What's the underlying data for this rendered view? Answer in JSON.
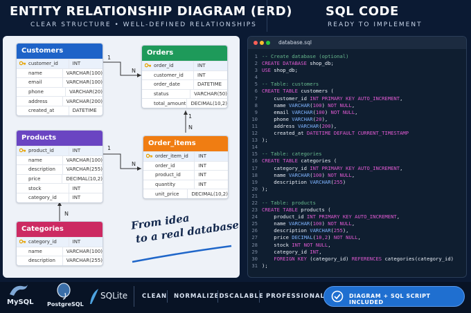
{
  "left_header": {
    "title": "ENTITY RELATIONSHIP DIAGRAM (ERD)",
    "subtitle": "CLEAR STRUCTURE  •  WELL-DEFINED RELATIONSHIPS"
  },
  "right_header": {
    "title": "SQL CODE",
    "subtitle": "READY TO IMPLEMENT"
  },
  "tables": {
    "customers": {
      "name": "Customers",
      "color": "#1e63c8",
      "rows": [
        [
          "customer_id",
          "INT"
        ],
        [
          "name",
          "VARCHAR(100)"
        ],
        [
          "email",
          "VARCHAR(100)"
        ],
        [
          "phone",
          "VARCHAR(20)"
        ],
        [
          "address",
          "VARCHAR(200)"
        ],
        [
          "created_at",
          "DATETIME"
        ]
      ]
    },
    "orders": {
      "name": "Orders",
      "color": "#1e9a5a",
      "rows": [
        [
          "order_id",
          "INT"
        ],
        [
          "customer_id",
          "INT"
        ],
        [
          "order_date",
          "DATETIME"
        ],
        [
          "status",
          "VARCHAR(50)"
        ],
        [
          "total_amount",
          "DECIMAL(10,2)"
        ]
      ]
    },
    "products": {
      "name": "Products",
      "color": "#6a45c2",
      "rows": [
        [
          "product_id",
          "INT"
        ],
        [
          "name",
          "VARCHAR(100)"
        ],
        [
          "description",
          "VARCHAR(255)"
        ],
        [
          "price",
          "DECIMAL(10,2)"
        ],
        [
          "stock",
          "INT"
        ],
        [
          "category_id",
          "INT"
        ]
      ]
    },
    "order_items": {
      "name": "Order_items",
      "color": "#f07d12",
      "rows": [
        [
          "order_item_id",
          "INT"
        ],
        [
          "order_id",
          "INT"
        ],
        [
          "product_id",
          "INT"
        ],
        [
          "quantity",
          "INT"
        ],
        [
          "unit_price",
          "DECIMAL(10,2)"
        ]
      ]
    },
    "categories": {
      "name": "Categories",
      "color": "#cc2a62",
      "rows": [
        [
          "category_id",
          "INT"
        ],
        [
          "name",
          "VARCHAR(100)"
        ],
        [
          "description",
          "VARCHAR(255)"
        ]
      ]
    }
  },
  "relations": {
    "one": "1",
    "many": "N"
  },
  "slogan": {
    "line1": "From idea",
    "line2": "to a real database"
  },
  "sql": {
    "file_name": "database.sql",
    "lines": [
      [
        [
          "cm",
          "-- Create database (optional)"
        ]
      ],
      [
        [
          "kw",
          "CREATE DATABASE"
        ],
        [
          "tx",
          " shop_db;"
        ]
      ],
      [
        [
          "kw",
          "USE"
        ],
        [
          "tx",
          " shop_db;"
        ]
      ],
      [],
      [
        [
          "cm",
          "-- Table: customers"
        ]
      ],
      [
        [
          "kw",
          "CREATE TABLE"
        ],
        [
          "tx",
          " customers ("
        ]
      ],
      [
        [
          "tx",
          "    customer_id "
        ],
        [
          "kw",
          "INT PRIMARY KEY AUTO_INCREMENT"
        ],
        [
          "tx",
          ","
        ]
      ],
      [
        [
          "tx",
          "    name "
        ],
        [
          "tp",
          "VARCHAR"
        ],
        [
          "tx",
          "("
        ],
        [
          "kw",
          "100"
        ],
        [
          "tx",
          ") "
        ],
        [
          "kw",
          "NOT NULL"
        ],
        [
          "tx",
          ","
        ]
      ],
      [
        [
          "tx",
          "    email "
        ],
        [
          "tp",
          "VARCHAR"
        ],
        [
          "tx",
          "("
        ],
        [
          "kw",
          "100"
        ],
        [
          "tx",
          ") "
        ],
        [
          "kw",
          "NOT NULL"
        ],
        [
          "tx",
          ","
        ]
      ],
      [
        [
          "tx",
          "    phone "
        ],
        [
          "tp",
          "VARCHAR"
        ],
        [
          "tx",
          "("
        ],
        [
          "kw",
          "20"
        ],
        [
          "tx",
          "),"
        ]
      ],
      [
        [
          "tx",
          "    address "
        ],
        [
          "tp",
          "VARCHAR"
        ],
        [
          "tx",
          "("
        ],
        [
          "kw",
          "200"
        ],
        [
          "tx",
          "),"
        ]
      ],
      [
        [
          "tx",
          "    created_at "
        ],
        [
          "kw",
          "DATETIME DEFAULT CURRENT_TIMESTAMP"
        ]
      ],
      [
        [
          "tx",
          ");"
        ]
      ],
      [],
      [
        [
          "cm",
          "-- Table: categories"
        ]
      ],
      [
        [
          "kw",
          "CREATE TABLE"
        ],
        [
          "tx",
          " categories ("
        ]
      ],
      [
        [
          "tx",
          "    category_id "
        ],
        [
          "kw",
          "INT PRIMARY KEY AUTO_INCREMENT"
        ],
        [
          "tx",
          ","
        ]
      ],
      [
        [
          "tx",
          "    name "
        ],
        [
          "tp",
          "VARCHAR"
        ],
        [
          "tx",
          "("
        ],
        [
          "kw",
          "100"
        ],
        [
          "tx",
          ") "
        ],
        [
          "kw",
          "NOT NULL"
        ],
        [
          "tx",
          ","
        ]
      ],
      [
        [
          "tx",
          "    description "
        ],
        [
          "tp",
          "VARCHAR"
        ],
        [
          "tx",
          "("
        ],
        [
          "kw",
          "255"
        ],
        [
          "tx",
          ")"
        ]
      ],
      [
        [
          "tx",
          ");"
        ]
      ],
      [],
      [
        [
          "cm",
          "-- Table: products"
        ]
      ],
      [
        [
          "kw",
          "CREATE TABLE"
        ],
        [
          "tx",
          " products ("
        ]
      ],
      [
        [
          "tx",
          "    product_id "
        ],
        [
          "kw",
          "INT PRIMARY KEY AUTO_INCREMENT"
        ],
        [
          "tx",
          ","
        ]
      ],
      [
        [
          "tx",
          "    name "
        ],
        [
          "tp",
          "VARCHAR"
        ],
        [
          "tx",
          "("
        ],
        [
          "kw",
          "100"
        ],
        [
          "tx",
          ") "
        ],
        [
          "kw",
          "NOT NULL"
        ],
        [
          "tx",
          ","
        ]
      ],
      [
        [
          "tx",
          "    description "
        ],
        [
          "tp",
          "VARCHAR"
        ],
        [
          "tx",
          "("
        ],
        [
          "kw",
          "255"
        ],
        [
          "tx",
          "),"
        ]
      ],
      [
        [
          "tx",
          "    price "
        ],
        [
          "tp",
          "DECIMAL"
        ],
        [
          "tx",
          "("
        ],
        [
          "kw",
          "10,2"
        ],
        [
          "tx",
          ") "
        ],
        [
          "kw",
          "NOT NULL"
        ],
        [
          "tx",
          ","
        ]
      ],
      [
        [
          "tx",
          "    stock "
        ],
        [
          "kw",
          "INT NOT NULL"
        ],
        [
          "tx",
          ","
        ]
      ],
      [
        [
          "tx",
          "    category_id "
        ],
        [
          "kw",
          "INT"
        ],
        [
          "tx",
          ","
        ]
      ],
      [
        [
          "tx",
          "    "
        ],
        [
          "kw",
          "FOREIGN KEY"
        ],
        [
          "tx",
          " (category_id) "
        ],
        [
          "kw",
          "REFERENCES"
        ],
        [
          "tx",
          " categories(category_id)"
        ]
      ],
      [
        [
          "tx",
          ");"
        ]
      ]
    ]
  },
  "footer": {
    "logos": [
      "MySQL",
      "PostgreSQL",
      "SQLite"
    ],
    "tags": [
      "CLEAN",
      "NORMALIZED",
      "SCALABLE",
      "PROFESSIONAL"
    ],
    "badge": "DIAGRAM + SQL SCRIPT INCLUDED"
  }
}
